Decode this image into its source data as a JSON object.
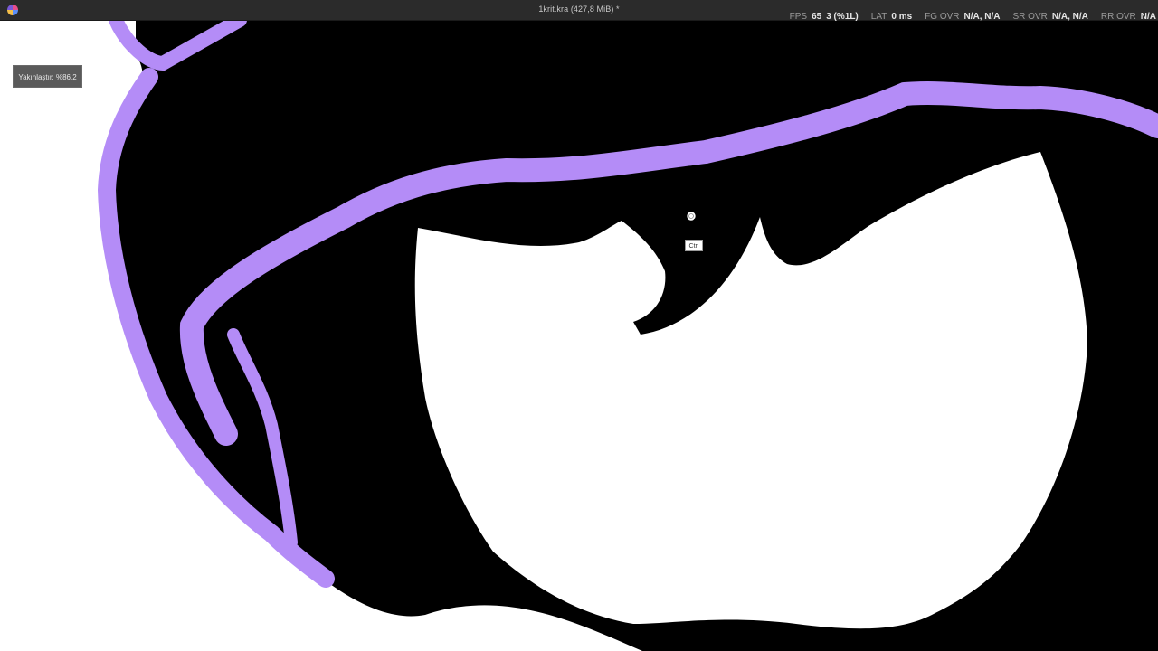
{
  "window": {
    "title": "1krit.kra (427,8 MiB) *",
    "app_icon": "krita-app-icon"
  },
  "performance": {
    "fps_label": "FPS",
    "fps_value": "65",
    "fps_extra": "3 (%1L)",
    "lat_label": "LAT",
    "lat_value": "0 ms",
    "fg_label": "FG OVR",
    "fg_value": "N/A, N/A",
    "sr_label": "SR OVR",
    "sr_value": "N/A, N/A",
    "rr_label": "RR OVR",
    "rr_value": "N/A"
  },
  "zoom": {
    "tooltip": "Yakınlaştır: %86,2"
  },
  "cursor": {
    "icon": "zoom-magnifier-icon",
    "modifier_hint": "Ctrl"
  },
  "colors": {
    "stroke_purple": "#b48cf7",
    "ink": "#000000",
    "paper": "#ffffff",
    "titlebar": "#2b2b2b"
  }
}
